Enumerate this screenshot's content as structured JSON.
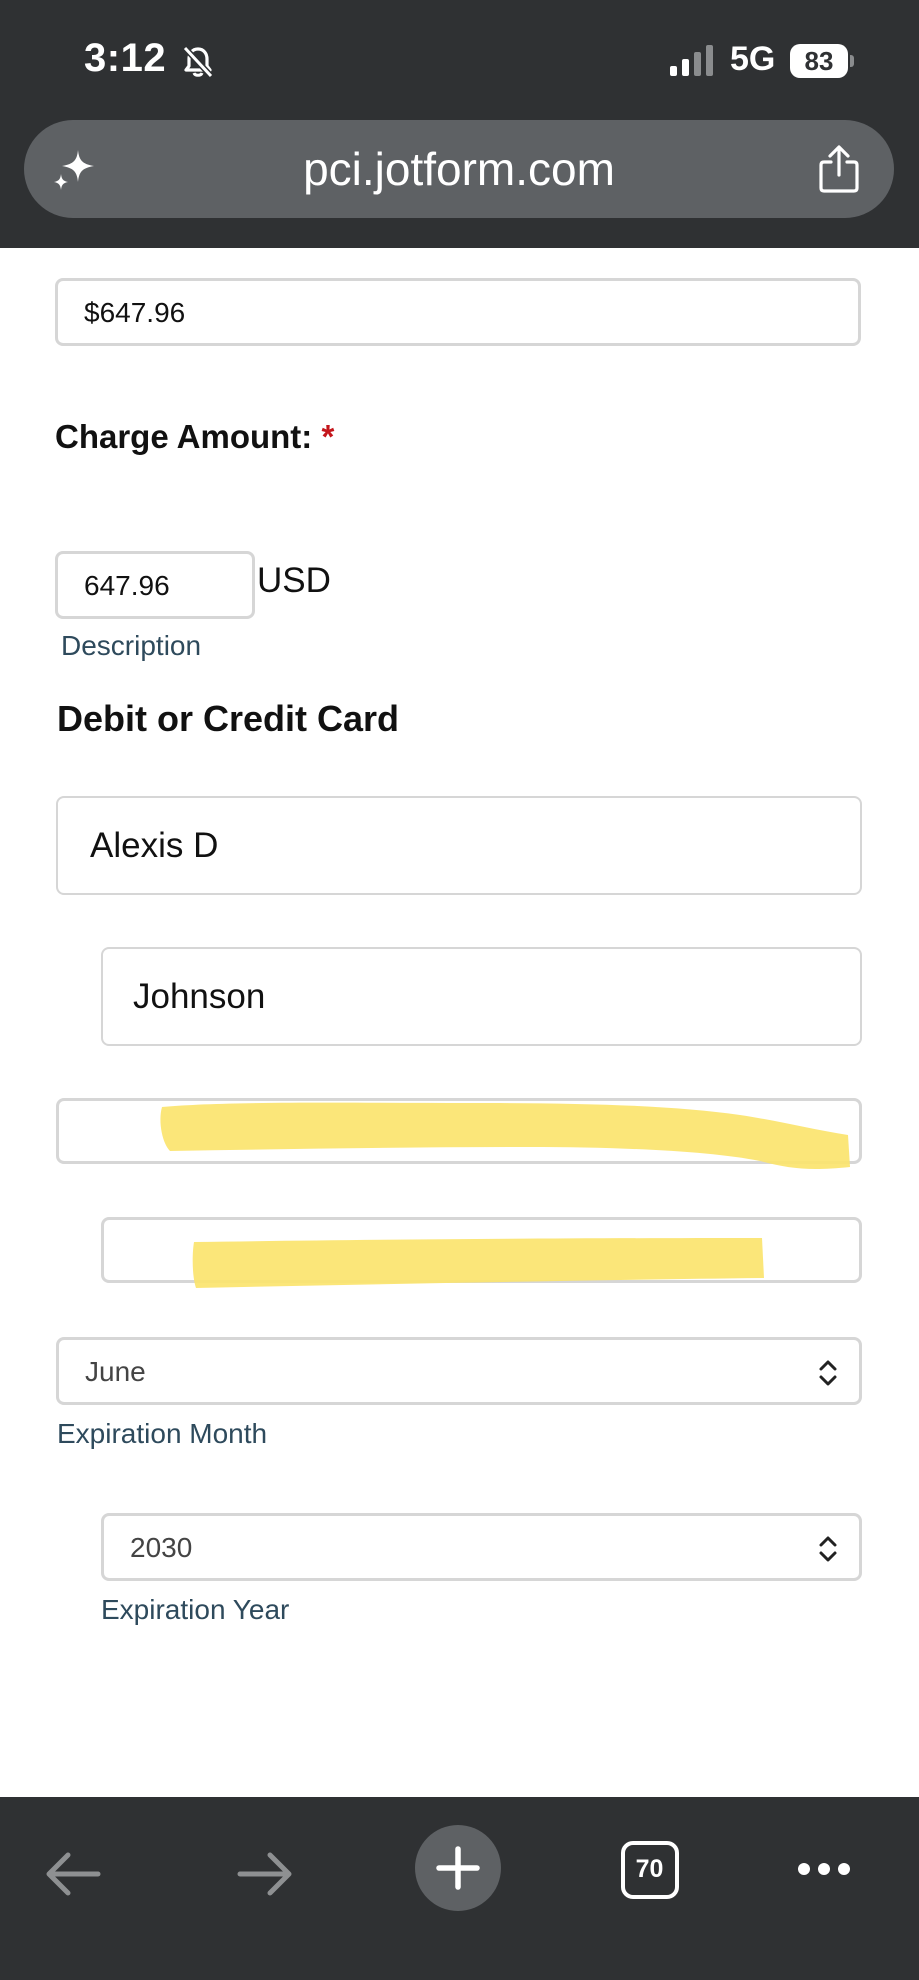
{
  "status_bar": {
    "time": "3:12",
    "network": "5G",
    "battery": "83",
    "icons": [
      "bell-slash-icon",
      "signal-icon"
    ]
  },
  "browser": {
    "url": "pci.jotform.com",
    "tab_count": "70",
    "icons": [
      "sparkle-icon",
      "share-icon",
      "back-icon",
      "forward-icon",
      "new-tab-icon",
      "tabs-icon",
      "more-icon"
    ]
  },
  "form": {
    "prev_total_value": "$647.96",
    "charge_amount_label": "Charge Amount:",
    "required_mark": "*",
    "charge_amount_value": "647.96",
    "currency": "USD",
    "description_sublabel": "Description",
    "card_section_title": "Debit or Credit Card",
    "first_name_value": "Alexis D",
    "last_name_value": "Johnson",
    "card_number_value": "",
    "security_code_value": "",
    "exp_month_value": "June",
    "exp_month_sublabel": "Expiration Month",
    "exp_year_value": "2030",
    "exp_year_sublabel": "Expiration Year"
  },
  "colors": {
    "chrome": "#2f3133",
    "url_pill": "#5e6164",
    "field_border": "#d6d6d6",
    "sublabel": "#2e4a5c",
    "required": "#c4161c",
    "redaction_highlight": "#fbe46e"
  }
}
